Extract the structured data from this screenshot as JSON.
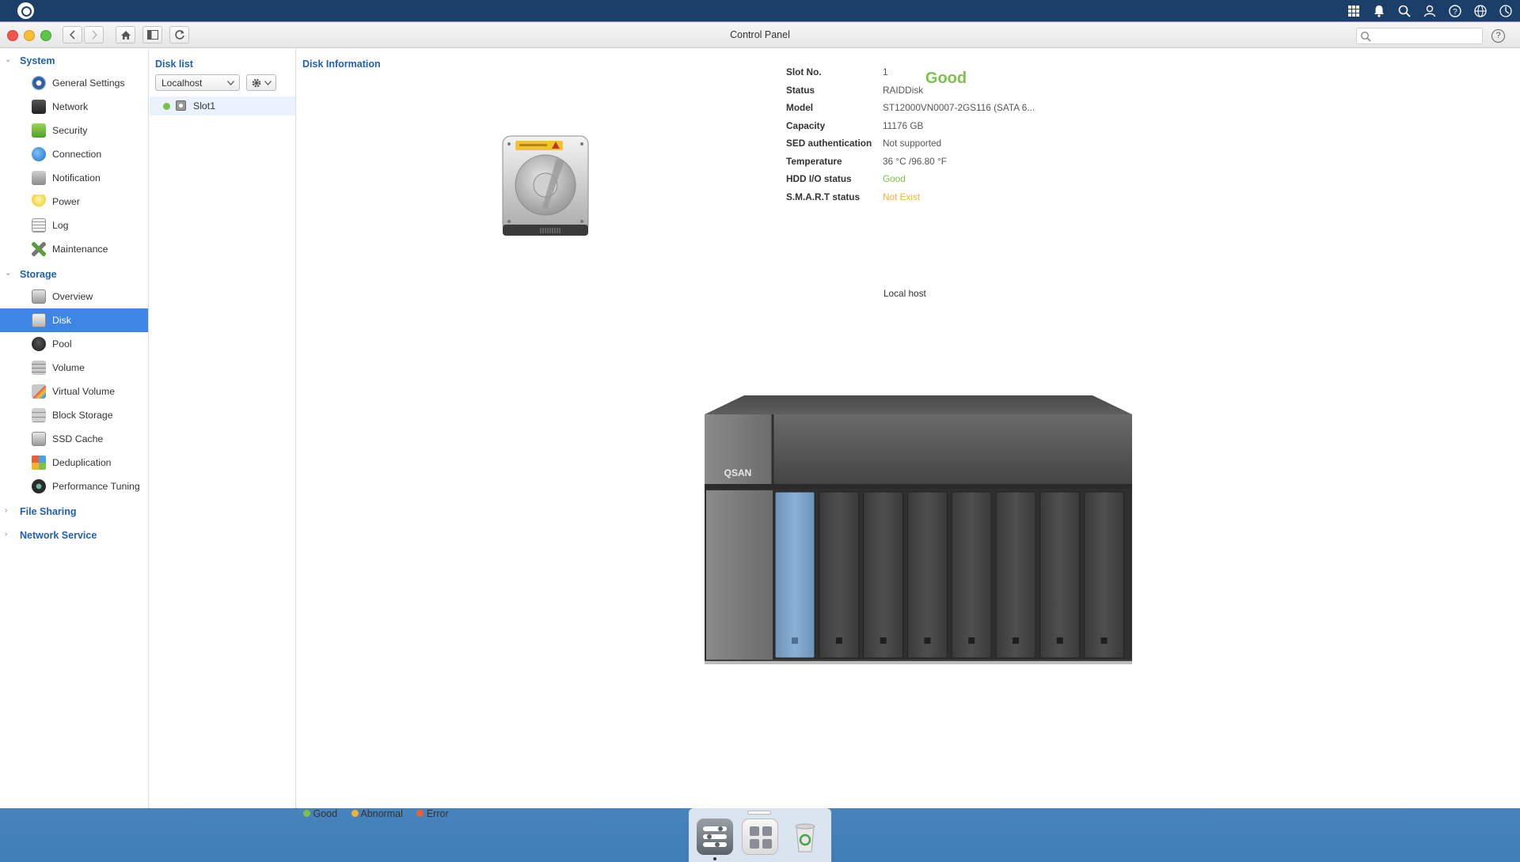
{
  "window": {
    "title": "Control Panel"
  },
  "search": {
    "placeholder": ""
  },
  "help_label": "?",
  "sidebar": {
    "sections": [
      {
        "title": "System",
        "expanded": true,
        "items": [
          {
            "label": "General Settings",
            "icon": "gear-icon"
          },
          {
            "label": "Network",
            "icon": "network-icon"
          },
          {
            "label": "Security",
            "icon": "lock-icon"
          },
          {
            "label": "Connection",
            "icon": "globe-icon"
          },
          {
            "label": "Notification",
            "icon": "bell-icon"
          },
          {
            "label": "Power",
            "icon": "bulb-icon"
          },
          {
            "label": "Log",
            "icon": "log-icon"
          },
          {
            "label": "Maintenance",
            "icon": "tools-icon"
          }
        ]
      },
      {
        "title": "Storage",
        "expanded": true,
        "items": [
          {
            "label": "Overview",
            "icon": "overview-icon"
          },
          {
            "label": "Disk",
            "icon": "disk-icon",
            "selected": true
          },
          {
            "label": "Pool",
            "icon": "pool-icon"
          },
          {
            "label": "Volume",
            "icon": "volume-icon"
          },
          {
            "label": "Virtual Volume",
            "icon": "virtual-volume-icon"
          },
          {
            "label": "Block Storage",
            "icon": "block-storage-icon"
          },
          {
            "label": "SSD Cache",
            "icon": "ssd-cache-icon"
          },
          {
            "label": "Deduplication",
            "icon": "dedup-icon"
          },
          {
            "label": "Performance Tuning",
            "icon": "gauge-icon"
          }
        ]
      },
      {
        "title": "File Sharing",
        "expanded": false,
        "items": []
      },
      {
        "title": "Network Service",
        "expanded": false,
        "items": []
      }
    ]
  },
  "disk_list": {
    "title": "Disk list",
    "host_select": "Localhost",
    "slots": [
      {
        "label": "Slot1",
        "status": "good"
      }
    ]
  },
  "disk_info": {
    "title": "Disk Information",
    "health": "Good",
    "fields": [
      {
        "key": "Slot No.",
        "value": "1",
        "color": "#555555"
      },
      {
        "key": "Status",
        "value": "RAIDDisk",
        "color": "#555555"
      },
      {
        "key": "Model",
        "value": "ST12000VN0007-2GS116 (SATA 6...",
        "color": "#555555"
      },
      {
        "key": "Capacity",
        "value": "11176 GB",
        "color": "#555555"
      },
      {
        "key": "SED authentication",
        "value": "Not supported",
        "color": "#555555"
      },
      {
        "key": "Temperature",
        "value": "36 °C /96.80 °F",
        "color": "#555555"
      },
      {
        "key": "HDD I/O status",
        "value": "Good",
        "color": "#7cc24a"
      },
      {
        "key": "S.M.A.R.T status",
        "value": "Not Exist",
        "color": "#f2b233"
      }
    ],
    "host_label": "Local host",
    "device_brand": "QSAN",
    "selected_bay": 1,
    "bay_count": 8
  },
  "legend": [
    {
      "label": "Good",
      "color": "#7cc24a"
    },
    {
      "label": "Abnormal",
      "color": "#f2b233"
    },
    {
      "label": "Error",
      "color": "#e8613a"
    }
  ],
  "colors": {
    "accent": "#3e86e6",
    "header_text": "#1f60b3",
    "good": "#7cc24a",
    "topbar": "#1c3f6a"
  }
}
